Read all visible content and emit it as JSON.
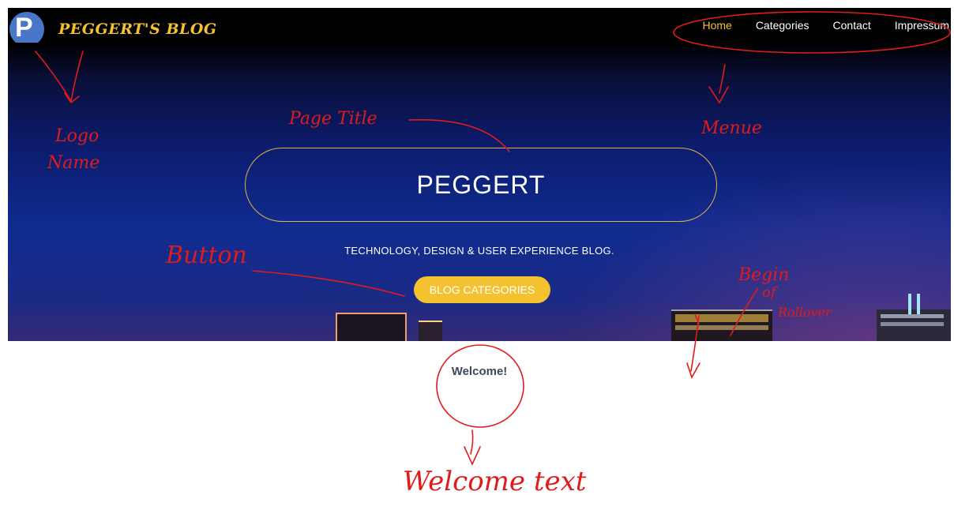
{
  "header": {
    "logo_letter": "P",
    "site_name": "PEGGERT'S BLOG",
    "nav": [
      "Home",
      "Categories",
      "Contact",
      "Impressum"
    ]
  },
  "hero": {
    "title": "PEGGERT",
    "tagline": "TECHNOLOGY, DESIGN & USER EXPERIENCE BLOG.",
    "cta_label": "BLOG CATEGORIES"
  },
  "welcome": "Welcome!",
  "annotations": {
    "logo_name_1": "Logo",
    "logo_name_2": "Name",
    "page_title": "Page Title",
    "menu": "Menue",
    "button": "Button",
    "begin_1": "Begin",
    "begin_2": "of",
    "begin_3": "Rollover",
    "welcome_text": "Welcome text"
  },
  "colors": {
    "accent": "#f4c230",
    "annotation": "#e01b1b",
    "header_bg": "#000000"
  }
}
